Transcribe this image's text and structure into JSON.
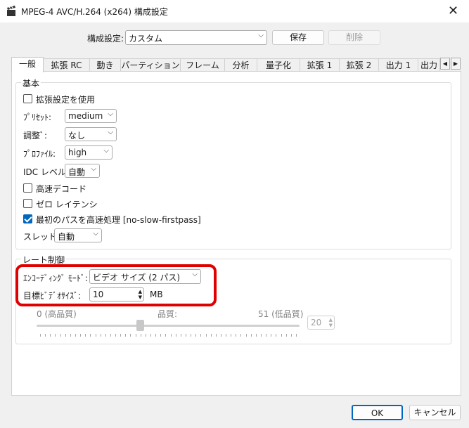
{
  "window": {
    "title": "MPEG-4 AVC/H.264 (x264) 構成設定",
    "close_glyph": "✕"
  },
  "profile_row": {
    "label": "構成設定:",
    "selected": "カスタム",
    "save_label": "保存",
    "delete_label": "削除"
  },
  "tabs": [
    {
      "label": "一般",
      "active": true
    },
    {
      "label": "拡張 RC"
    },
    {
      "label": "動き"
    },
    {
      "label": "パーティション"
    },
    {
      "label": "フレーム"
    },
    {
      "label": "分析"
    },
    {
      "label": "量子化"
    },
    {
      "label": "拡張 1"
    },
    {
      "label": "拡張 2"
    },
    {
      "label": "出力 1"
    },
    {
      "label": "出力"
    }
  ],
  "basic": {
    "title": "基本",
    "advanced_label": "拡張設定を使用",
    "advanced_checked": false,
    "preset_label": "ﾌﾟﾘｾｯﾄ:",
    "preset_value": "medium",
    "tune_label": "調整ﾞ:",
    "tune_value": "なし",
    "profile_label": "ﾌﾟﾛﾌｧｲﾙ:",
    "profile_value": "high",
    "idc_label": "IDC レベル:",
    "idc_value": "自動",
    "fast_decode_label": "高速デコード",
    "fast_decode_checked": false,
    "zero_latency_label": "ゼロ レイテンシ",
    "zero_latency_checked": false,
    "fast_first_pass_label": "最初のパスを高速処理 [no-slow-firstpass]",
    "fast_first_pass_checked": true,
    "threads_label": "スレッド:",
    "threads_value": "自動"
  },
  "rate_control": {
    "title": "レート制御",
    "mode_label": "ｴﾝｺｰﾃﾞｨﾝｸﾞ ﾓｰﾄﾞ:",
    "mode_value": "ビデオ サイズ (2 パス)",
    "target_label": "目標ﾋﾞﾃﾞｵｻｲｽﾞ:",
    "target_value": "10",
    "target_unit": "MB",
    "quality_min_label": "0 (高品質)",
    "quality_label": "品質:",
    "quality_max_label": "51 (低品質)",
    "quality_value": "20"
  },
  "footer": {
    "ok_label": "OK",
    "cancel_label": "キャンセル"
  },
  "colors": {
    "accent": "#0067c0",
    "highlight": "#e00000"
  }
}
